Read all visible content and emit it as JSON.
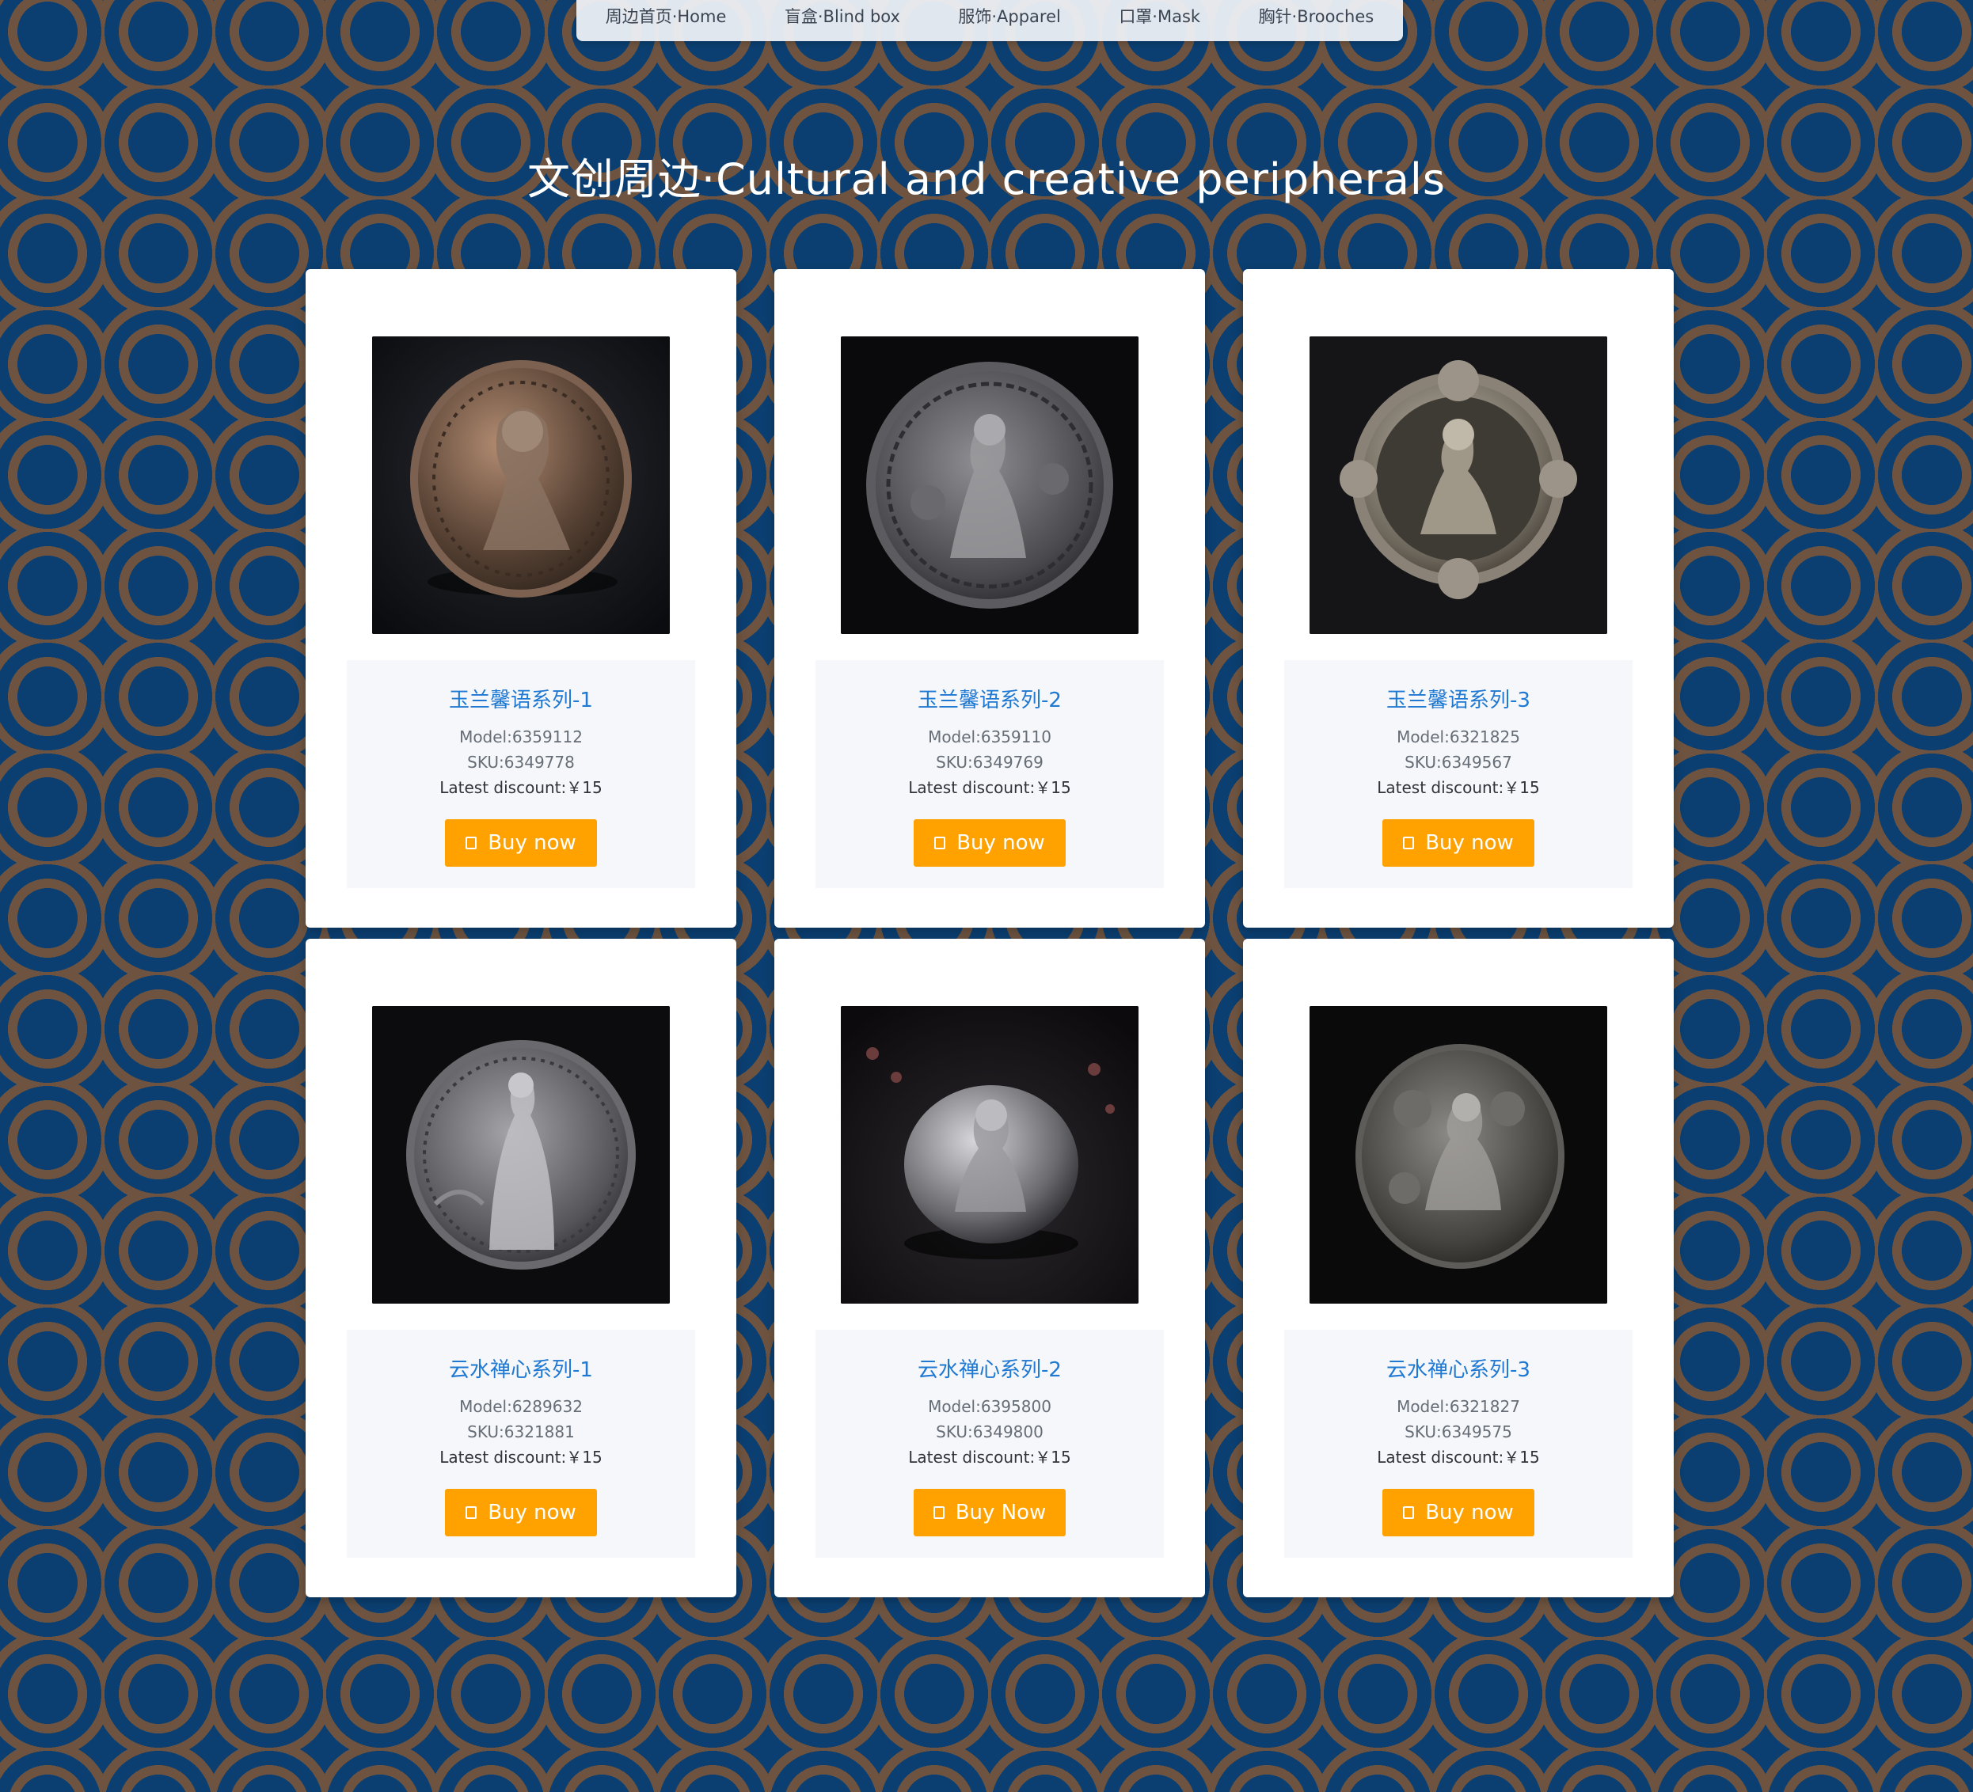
{
  "nav": {
    "items": [
      {
        "label": "周边首页·Home"
      },
      {
        "label": "盲盒·Blind box"
      },
      {
        "label": "服饰·Apparel"
      },
      {
        "label": "口罩·Mask"
      },
      {
        "label": "胸针·Brooches"
      }
    ]
  },
  "page": {
    "title": "文创周边·Cultural and creative peripherals"
  },
  "products": [
    {
      "name": "玉兰馨语系列-1",
      "model": "Model:6359112",
      "sku": "SKU:6349778",
      "price": "Latest discount:￥15",
      "button": "Buy now"
    },
    {
      "name": "玉兰馨语系列-2",
      "model": "Model:6359110",
      "sku": "SKU:6349769",
      "price": "Latest discount:￥15",
      "button": "Buy now"
    },
    {
      "name": "玉兰馨语系列-3",
      "model": "Model:6321825",
      "sku": "SKU:6349567",
      "price": "Latest discount:￥15",
      "button": "Buy now"
    },
    {
      "name": "云水禅心系列-1",
      "model": "Model:6289632",
      "sku": "SKU:6321881",
      "price": "Latest discount:￥15",
      "button": "Buy now"
    },
    {
      "name": "云水禅心系列-2",
      "model": "Model:6395800",
      "sku": "SKU:6349800",
      "price": "Latest discount:￥15",
      "button": "Buy Now"
    },
    {
      "name": "云水禅心系列-3",
      "model": "Model:6321827",
      "sku": "SKU:6349575",
      "price": "Latest discount:￥15",
      "button": "Buy now"
    }
  ],
  "icons": {
    "button": "cart-icon"
  },
  "colors": {
    "accent": "#ffa200",
    "link": "#1f78d1",
    "background": "#0b3f71",
    "pattern": "#6e5440"
  }
}
